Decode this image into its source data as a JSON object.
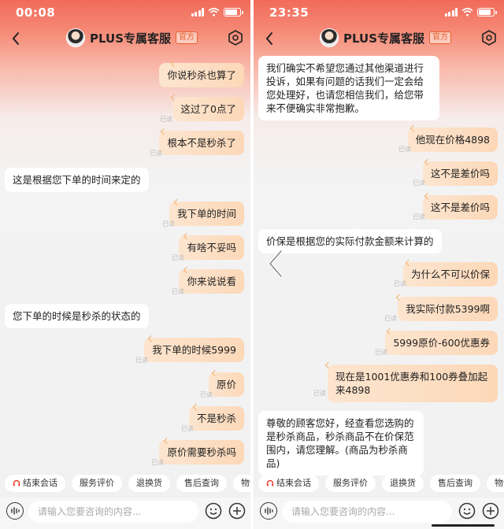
{
  "left": {
    "status": {
      "time": "00:08"
    },
    "header": {
      "title": "PLUS专属客服",
      "badge": "官方"
    },
    "messages": [
      {
        "side": "me",
        "text": "你说秒杀也算了"
      },
      {
        "side": "me",
        "text": "这过了0点了",
        "read": "已读"
      },
      {
        "side": "me",
        "text": "根本不是秒杀了",
        "read": "已读"
      },
      {
        "side": "agent",
        "text": "这是根据您下单的时间来定的"
      },
      {
        "side": "me",
        "text": "我下单的时间",
        "read": "已读"
      },
      {
        "side": "me",
        "text": "有啥不妥吗",
        "read": "已读"
      },
      {
        "side": "me",
        "text": "你来说说看",
        "read": "已读"
      },
      {
        "side": "agent",
        "text": "您下单的时候是秒杀的状态的"
      },
      {
        "side": "me",
        "text": "我下单的时候5999",
        "read": "已读"
      },
      {
        "side": "me",
        "text": "原价",
        "read": "已读"
      },
      {
        "side": "me",
        "text": "不是秒杀",
        "read": "已读"
      },
      {
        "side": "me",
        "text": "原价需要秒杀吗",
        "read": "已读"
      }
    ],
    "quick": [
      "结束会话",
      "服务评价",
      "退换货",
      "售后查询",
      "物流查询"
    ],
    "input": {
      "placeholder": "请输入您要咨询的内容..."
    }
  },
  "right": {
    "status": {
      "time": "23:35"
    },
    "header": {
      "title": "PLUS专属客服",
      "badge": "官方"
    },
    "messages": [
      {
        "side": "agent",
        "text": "我们确实不希望您通过其他渠道进行投诉，如果有问题的话我们一定会给您处理好，也请您相信我们，给您带来不便确实非常抱歉。"
      },
      {
        "side": "me",
        "text": "他现在价格4898",
        "read": "已读"
      },
      {
        "side": "me",
        "text": "这不是差价吗",
        "read": "已读"
      },
      {
        "side": "me",
        "text": "这不是差价吗",
        "read": "已读"
      },
      {
        "side": "agent",
        "text": "价保是根据您的实际付款金额来计算的"
      },
      {
        "side": "me",
        "text": "为什么不可以价保",
        "read": "已读"
      },
      {
        "side": "me",
        "text": "我实际付款5399啊",
        "read": "已读"
      },
      {
        "side": "me",
        "text": "5999原价-600优惠券",
        "read": "已读"
      },
      {
        "side": "me",
        "text": "现在是1001优惠券和100券叠加起来4898",
        "read": "已读"
      },
      {
        "side": "agent",
        "text": "尊敬的顾客您好，经查看您选购的是秒杀商品，秒杀商品不在价保范围内，请您理解。(商品为秒杀商品)"
      }
    ],
    "quick": [
      "结束会话",
      "服务评价",
      "退换货",
      "售后查询",
      "物流查询"
    ],
    "input": {
      "placeholder": "请输入您要咨询的内容..."
    }
  },
  "icons": [
    "back-chevron",
    "settings-hexagon",
    "voice-wave",
    "emoji-face",
    "plus-circle",
    "headset",
    "chevron-left"
  ],
  "colors": {
    "header_red": "#f26a5a",
    "my_bubble": "#fcd8b8",
    "agent_bubble": "#ffffff",
    "badge_orange": "#e8612e"
  }
}
